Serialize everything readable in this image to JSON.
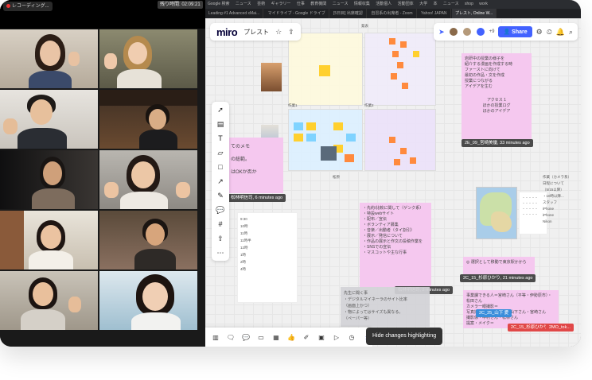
{
  "zoom": {
    "recording_label": "レコーディング...",
    "timer": "残り時間: 02:09:21"
  },
  "browser": {
    "bookmarks": [
      "Google 検索",
      "ニュース",
      "芸術",
      "ギャラリー",
      "仕事",
      "教育機関",
      "ニュース",
      "情報収集",
      "活動個人",
      "活動団体",
      "大学",
      "本",
      "ニュース",
      "shop",
      "work"
    ],
    "tabs": [
      "Leading #1 Advanced xMai...",
      "マイドライブ - Google ドライブ",
      "[5日目] 出席確認",
      "自習系の出席者 - Zoom",
      "Yahoo! JAPAN",
      "プレスト, Online W..."
    ]
  },
  "miro": {
    "logo": "miro",
    "board_name": "プレスト",
    "share_label": "Share",
    "plus_count": "+9",
    "notif_count": "4",
    "hide_highlight_tooltip": "Hide changes highlighting"
  },
  "tags": {
    "t1": "2E_09_宮崎美優, 33 minutes ago",
    "t2": "松林明信司, 6 minutes ago",
    "t3": "2C_15_杉原ひかり, 21 minutes ago",
    "t4": "松林明信司, 2 minutes ago",
    "t5": "2C_25_山下 愛",
    "t6": "2C_15_杉原ひかり",
    "t7": "2MO_tok..."
  },
  "cards": {
    "left_snippet": [
      "てのメモ",
      "の総範。",
      "はOKか否か"
    ],
    "pink_right": [
      "岩研中の授業の様子を",
      "紹介する漫画を作成する時",
      "ファーストに向けて",
      "最初の作品・文を作成",
      "授業につながる",
      "アイデアを生む"
    ],
    "pink_right_footer": [
      "アクセス 1",
      "ほかの授業ログ",
      "ほかのアイデア"
    ],
    "schedule": [
      "9:30",
      "10時",
      "11時",
      "11時半",
      "12時",
      "1時",
      "2時",
      "4時"
    ],
    "requests": [
      "・先約/比較に関して（ゲンク系）",
      "・特設webサイト",
      "・配布／宣伝",
      "・ボランティア募集",
      "・音楽／出動者（タイ割引）",
      "・展示／発信について",
      "・作品の展示と作文の投稿作業を",
      "・SNSでの宣伝",
      "・マスコットや主な行事"
    ],
    "gray_note": [
      "先生に聞く事",
      "・デジタルマイネーラのサイト比率",
      "（画面上かつ）",
      "・物によってはサイズも異なる。",
      "（ペーパー等）"
    ],
    "bottom_pink": [
      "事業課できる人＝宮崎さん（平等・伊勢原市）・松田さん",
      "カメラ一眼撮影＝",
      "写真撮影者＝鈴木さん・山下さん・宮崎さん",
      "撮影係・中村さん・松林さん",
      "提案・メイク＝"
    ],
    "right_edge": [
      "作業（カメラ系）",
      "日程について",
      "（5/15以降）",
      "・10時以降...",
      "スタッフ",
      "iPhone",
      "iPhone",
      "Nikon"
    ],
    "note_pink_bottom_left": "◎ 選択として移動で東京駅かから",
    "side_label": "松原",
    "frame_label_a": "作業1",
    "frame_label_b": "作業2",
    "center_label": "発表"
  }
}
